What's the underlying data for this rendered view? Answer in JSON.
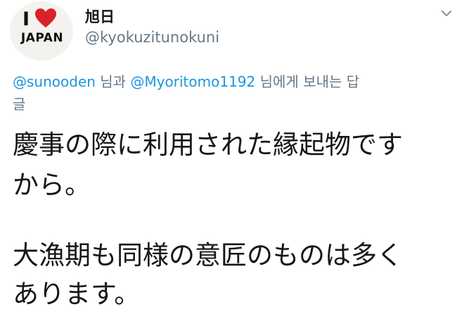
{
  "user": {
    "display_name": "旭日",
    "handle": "@kyokuzitunokuni",
    "avatar": {
      "letter": "I",
      "text": "JAPAN",
      "heart_color": "#d8232a"
    }
  },
  "reply_context": {
    "mention_1": "@sunooden",
    "connector": " 님과 ",
    "mention_2": "@Myoritomo1192",
    "suffix": " 님에게 보내는 답",
    "tail": "글"
  },
  "tweet": {
    "lines": [
      "慶事の際に利用された縁起物です",
      "から。",
      "大漁期も同様の意匠のものは多く",
      "あります。"
    ]
  },
  "icons": {
    "menu": "chevron-down-icon"
  },
  "colors": {
    "mention": "#1b95e0",
    "secondary_text": "#657786",
    "primary_text": "#14171a"
  }
}
